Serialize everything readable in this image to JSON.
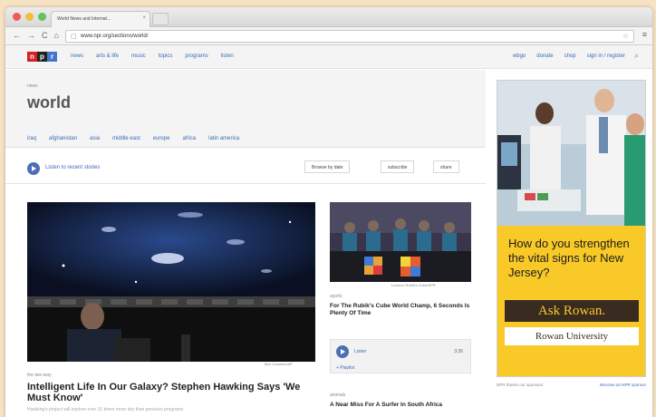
{
  "browser": {
    "tab_title": "World News and Internat...",
    "tab_close": "×",
    "back": "←",
    "forward": "→",
    "reload": "C",
    "home": "⌂",
    "url": "www.npr.org/sections/world/",
    "star": "☆",
    "menu": "≡"
  },
  "npr": {
    "logo": [
      "n",
      "p",
      "r"
    ],
    "nav": [
      "news",
      "arts & life",
      "music",
      "topics",
      "programs",
      "listen"
    ],
    "nav_right": [
      "wbgo",
      "donate",
      "shop",
      "sign in / register"
    ],
    "search": "⌕"
  },
  "section": {
    "kicker": "news",
    "title": "world",
    "subnav": [
      "iraq",
      "afghanistan",
      "asia",
      "middle east",
      "europe",
      "africa",
      "latin america"
    ]
  },
  "actions": {
    "listen": "Listen to recent stories",
    "browse": "Browse by date",
    "subscribe": "subscribe",
    "share": "share"
  },
  "hero": {
    "credit": "Ben Cranston/AP",
    "kicker": "the two-way",
    "title": "Intelligent Life In Our Galaxy? Stephen Hawking Says 'We Must Know'",
    "teaser": "Hawking's project will explore over 10 times more sky than previous programs"
  },
  "side_story": {
    "credit": "Lorenzo Rubik's Cube/NPR",
    "kicker": "sports",
    "title": "For The Rubik's Cube World Champ, 6 Seconds Is Plenty Of Time",
    "audio_label": "Listen",
    "audio_time": "3:36",
    "playlist": "+ Playlist"
  },
  "side_story2": {
    "kicker": "animals",
    "title": "A Near Miss For A Surfer In South Africa"
  },
  "ad": {
    "question": "How do you strengthen the vital signs for New Jersey?",
    "cta": "Ask Rowan.",
    "brand": "Rowan University",
    "footer_left": "NPR thanks our sponsors",
    "footer_right": "Become an NPR sponsor"
  },
  "colors": {
    "npr_red": "#d62021",
    "npr_blue": "#4774cc",
    "link": "#3a6bb5",
    "ad_yellow": "#f9c928"
  }
}
